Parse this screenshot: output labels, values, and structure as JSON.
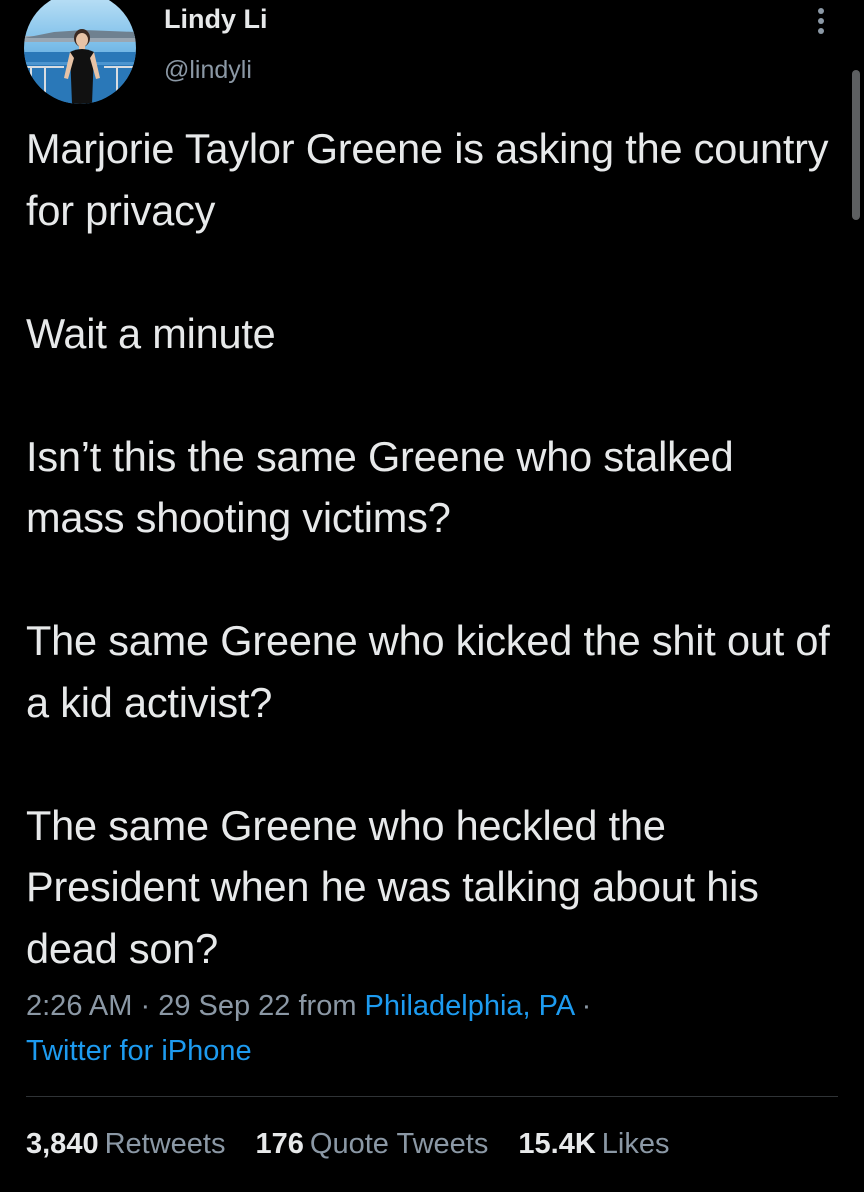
{
  "author": {
    "name": "Lindy Li",
    "handle": "@lindyli"
  },
  "tweet": {
    "paragraphs": [
      "Marjorie Taylor Greene is asking the country for privacy",
      "Wait a minute",
      "Isn’t this the same Greene who stalked mass shooting victims?",
      "The same Greene who kicked the shit out of a kid activist?",
      "The same Greene who heckled the President when he was talking about his dead son?"
    ]
  },
  "meta": {
    "time": "2:26 AM",
    "separator": " · ",
    "date": "29 Sep 22",
    "from_label": " from ",
    "location": "Philadelphia, PA",
    "trailing_separator": " ·",
    "source": "Twitter for iPhone"
  },
  "stats": {
    "retweets_count": "3,840",
    "retweets_label": "Retweets",
    "quote_tweets_count": "176",
    "quote_tweets_label": "Quote Tweets",
    "likes_count": "15.4K",
    "likes_label": "Likes"
  },
  "colors": {
    "background": "#000000",
    "text_primary": "#e7e9ea",
    "text_secondary": "#8b98a5",
    "link": "#1d9bf0",
    "divider": "#2f3336"
  },
  "icons": {
    "more": "more-options-icon",
    "avatar": "profile-photo"
  }
}
